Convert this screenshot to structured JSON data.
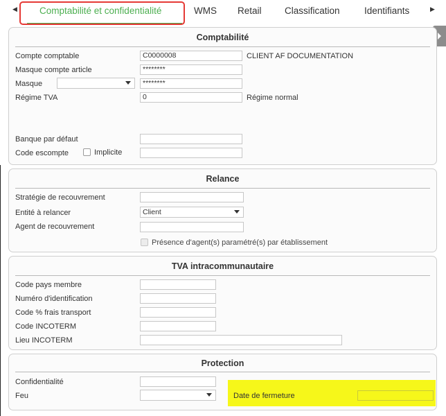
{
  "tabs": [
    {
      "label": "Comptabilité et confidentialité",
      "active": true
    },
    {
      "label": "WMS"
    },
    {
      "label": "Retail"
    },
    {
      "label": "Classification"
    },
    {
      "label": "Identifiants"
    }
  ],
  "icons": {
    "tab_left": "chevron-left-icon",
    "tab_right": "chevron-right-icon",
    "side_panel": "expand-right-icon"
  },
  "colors": {
    "active_tab": "#4caf50",
    "highlight_box": "#e53935",
    "highlight_area": "#f6f71a"
  },
  "comptabilite": {
    "title": "Comptabilité",
    "compte_label": "Compte comptable",
    "compte_value": "C0000008",
    "compte_desc": "CLIENT AF  DOCUMENTATION",
    "masque_article_label": "Masque compte article",
    "masque_article_value": "********",
    "masque_label": "Masque",
    "masque_select": "",
    "masque_value": "********",
    "regime_label": "Régime TVA",
    "regime_value": "0",
    "regime_desc": "Régime normal",
    "banque_label": "Banque par défaut",
    "banque_value": "",
    "escompte_label": "Code escompte",
    "implicite_label": "Implicite",
    "escompte_value": ""
  },
  "relance": {
    "title": "Relance",
    "strategie_label": "Stratégie de recouvrement",
    "strategie_value": "",
    "entite_label": "Entité à relancer",
    "entite_value": "Client",
    "agent_label": "Agent de recouvrement",
    "agent_value": "",
    "presence_label": "Présence d'agent(s) paramétré(s) par établissement"
  },
  "tva": {
    "title": "TVA intracommunautaire",
    "pays_label": "Code pays membre",
    "pays_value": "",
    "numero_label": "Numéro d'identification",
    "numero_value": "",
    "frais_label": "Code % frais transport",
    "frais_value": "",
    "incoterm_label": "Code INCOTERM",
    "incoterm_value": "",
    "lieu_label": "Lieu INCOTERM",
    "lieu_value": ""
  },
  "protection": {
    "title": "Protection",
    "confidentialite_label": "Confidentialité",
    "confidentialite_value": "",
    "feu_label": "Feu",
    "feu_value": "",
    "date_fermeture_label": "Date de fermeture",
    "date_fermeture_value": ""
  }
}
